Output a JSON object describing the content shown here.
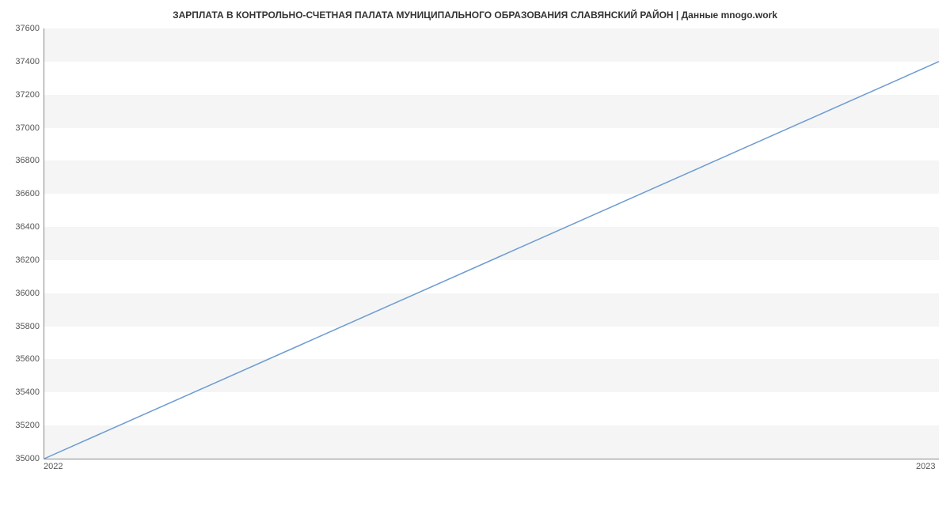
{
  "chart_data": {
    "type": "line",
    "title": "ЗАРПЛАТА В КОНТРОЛЬНО-СЧЕТНАЯ ПАЛАТА МУНИЦИПАЛЬНОГО ОБРАЗОВАНИЯ СЛАВЯНСКИЙ РАЙОН | Данные mnogo.work",
    "x": [
      "2022",
      "2023"
    ],
    "values": [
      35000,
      37400
    ],
    "xlabel": "",
    "ylabel": "",
    "ylim": [
      35000,
      37600
    ],
    "yticks": [
      35000,
      35200,
      35400,
      35600,
      35800,
      36000,
      36200,
      36400,
      36600,
      36800,
      37000,
      37200,
      37400,
      37600
    ],
    "line_color": "#6b9bd1",
    "band_color": "#f5f5f5"
  }
}
